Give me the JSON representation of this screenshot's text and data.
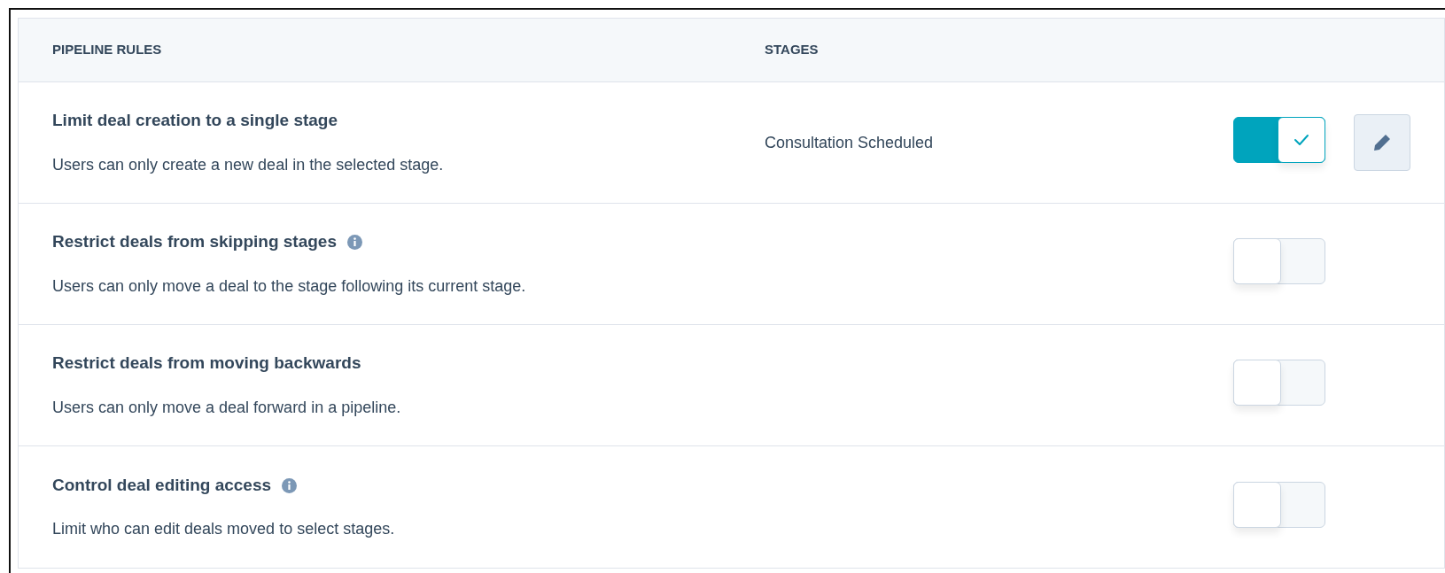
{
  "table": {
    "columns": [
      "PIPELINE RULES",
      "STAGES"
    ],
    "rows": [
      {
        "title": "Limit deal creation to a single stage",
        "info": false,
        "description": "Users can only create a new deal in the selected stage.",
        "stage": "Consultation Scheduled",
        "on": true,
        "editable": true
      },
      {
        "title": "Restrict deals from skipping stages",
        "info": true,
        "description": "Users can only move a deal to the stage following its current stage.",
        "on": false,
        "editable": false
      },
      {
        "title": "Restrict deals from moving backwards",
        "info": false,
        "description": "Users can only move a deal forward in a pipeline.",
        "on": false,
        "editable": false
      },
      {
        "title": "Control deal editing access",
        "info": true,
        "description": "Limit who can edit deals moved to select stages.",
        "on": false,
        "editable": false
      }
    ]
  }
}
